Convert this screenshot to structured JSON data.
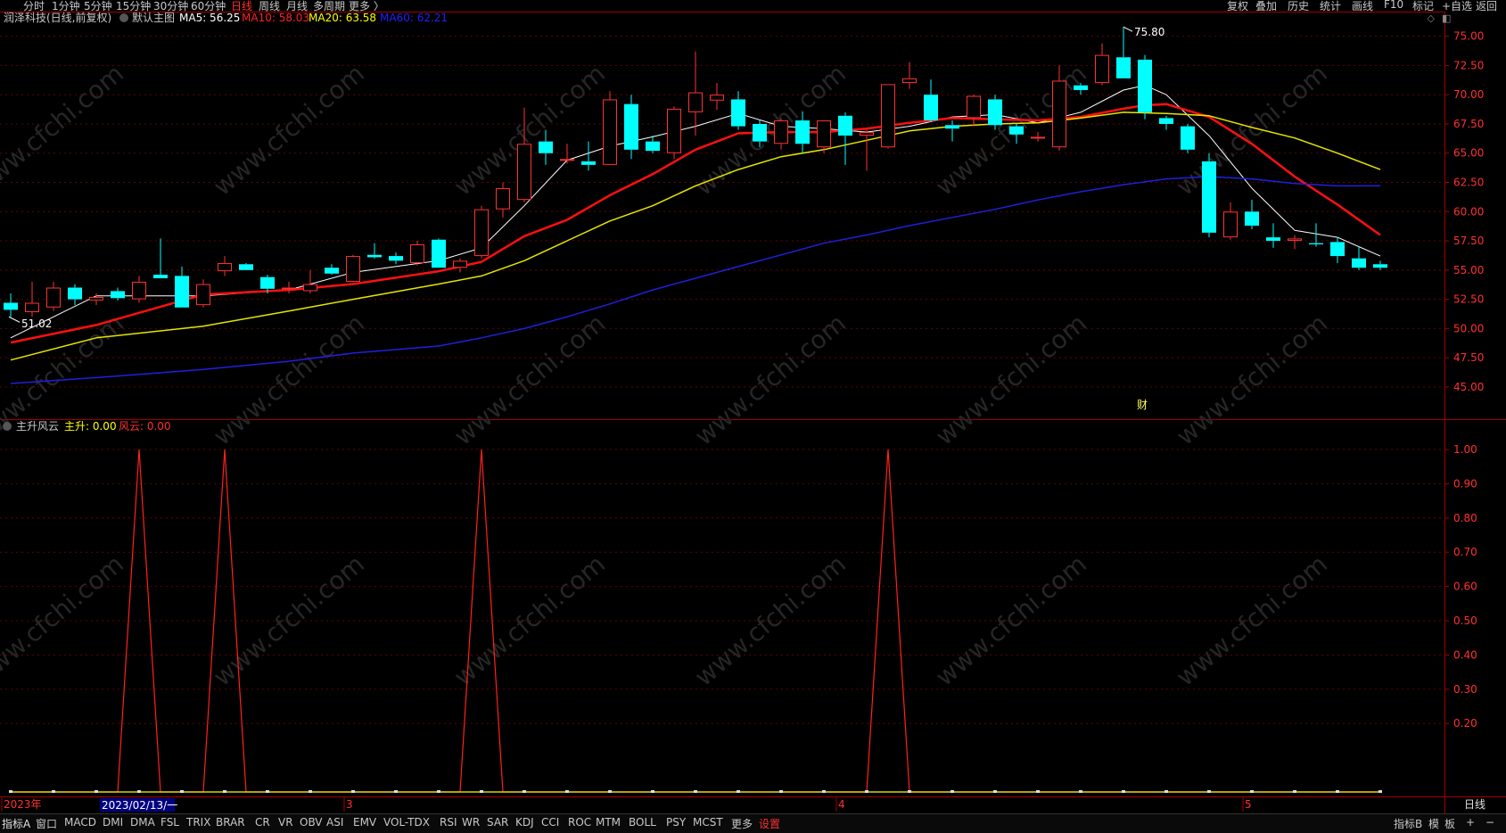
{
  "period_tabs": [
    "分时",
    "1分钟",
    "5分钟",
    "15分钟",
    "30分钟",
    "60分钟",
    "日线",
    "周线",
    "月线",
    "多周期",
    "更多 〉"
  ],
  "active_period": "日线",
  "toolbar_right": [
    "复权",
    "叠加",
    "历史",
    "统计",
    "画线",
    "F10",
    "标记",
    "+自选",
    "返回"
  ],
  "main_panel": {
    "title": "润泽科技(日线,前复权)",
    "indicator_name": "默认主图",
    "ma_labels": [
      {
        "text": "MA5: 56.25",
        "color": "#ffffff"
      },
      {
        "text": "MA10: 58.03",
        "color": "#ff2020"
      },
      {
        "text": "MA20: 63.58",
        "color": "#ffff00"
      },
      {
        "text": "MA60: 62.21",
        "color": "#2020ff"
      }
    ],
    "high_marker": "75.80",
    "low_marker": "51.02",
    "event_marker": "财"
  },
  "sub_panel": {
    "title": "主升风云",
    "labels": [
      {
        "text": "主升: 0.00",
        "color": "#ffff00"
      },
      {
        "text": "风云: 0.00",
        "color": "#ff3030"
      }
    ]
  },
  "date_axis": {
    "labels": [
      {
        "text": "2023年",
        "index": 0
      },
      {
        "text": "3",
        "index": 16
      },
      {
        "text": "4",
        "index": 39
      },
      {
        "text": "5",
        "index": 58
      }
    ],
    "cursor_label": "2023/02/13/一",
    "cursor_index": 5,
    "period_label": "日线"
  },
  "bottom_tabs": [
    "指标A",
    "窗口",
    "MACD",
    "DMI",
    "DMA",
    "FSL",
    "TRIX",
    "BRAR",
    "CR",
    "VR",
    "OBV",
    "ASI",
    "EMV",
    "VOL-TDX",
    "RSI",
    "WR",
    "SAR",
    "KDJ",
    "CCI",
    "ROC",
    "MTM",
    "BOLL",
    "PSY",
    "MCST",
    "更多",
    "设置"
  ],
  "bottom_right": [
    "指标B",
    "模",
    "板",
    "+",
    "−"
  ],
  "chart_data": [
    {
      "type": "candlestick",
      "title": "润泽科技(日线,前复权)",
      "ylim": [
        44,
        76.5
      ],
      "yticks": [
        45,
        47.5,
        50,
        52.5,
        55,
        57.5,
        60,
        62.5,
        65,
        67.5,
        70,
        72.5,
        75
      ],
      "ytick_labels": [
        "45.00",
        "47.50",
        "50.00",
        "52.50",
        "55.00",
        "57.50",
        "60.00",
        "62.50",
        "65.00",
        "67.50",
        "70.00",
        "72.50",
        "75.00"
      ],
      "up_color": "#ff3232",
      "down_color": "#00ffff",
      "candles": [
        {
          "o": 52.2,
          "h": 53.0,
          "l": 51.0,
          "c": 51.6
        },
        {
          "o": 51.4,
          "h": 54.0,
          "l": 51.0,
          "c": 52.2
        },
        {
          "o": 51.8,
          "h": 54.0,
          "l": 51.5,
          "c": 53.5
        },
        {
          "o": 53.5,
          "h": 53.8,
          "l": 52.0,
          "c": 52.5
        },
        {
          "o": 52.4,
          "h": 53.0,
          "l": 52.0,
          "c": 52.7
        },
        {
          "o": 53.2,
          "h": 53.5,
          "l": 52.4,
          "c": 52.6
        },
        {
          "o": 52.5,
          "h": 54.5,
          "l": 52.2,
          "c": 54.0
        },
        {
          "o": 54.6,
          "h": 57.7,
          "l": 54.3,
          "c": 54.3
        },
        {
          "o": 54.5,
          "h": 55.3,
          "l": 51.8,
          "c": 51.8
        },
        {
          "o": 52.0,
          "h": 54.2,
          "l": 51.8,
          "c": 53.8
        },
        {
          "o": 54.9,
          "h": 56.2,
          "l": 54.5,
          "c": 55.6
        },
        {
          "o": 55.5,
          "h": 55.6,
          "l": 55.0,
          "c": 55.0
        },
        {
          "o": 54.4,
          "h": 54.6,
          "l": 53.0,
          "c": 53.4
        },
        {
          "o": 53.5,
          "h": 54.0,
          "l": 53.0,
          "c": 53.5
        },
        {
          "o": 53.2,
          "h": 55.0,
          "l": 53.0,
          "c": 53.8
        },
        {
          "o": 55.2,
          "h": 55.5,
          "l": 54.6,
          "c": 54.7
        },
        {
          "o": 54.0,
          "h": 56.3,
          "l": 54.0,
          "c": 56.2
        },
        {
          "o": 56.3,
          "h": 57.3,
          "l": 56.0,
          "c": 56.1
        },
        {
          "o": 56.2,
          "h": 56.5,
          "l": 55.5,
          "c": 55.8
        },
        {
          "o": 55.6,
          "h": 57.5,
          "l": 55.4,
          "c": 57.2
        },
        {
          "o": 57.6,
          "h": 57.7,
          "l": 55.2,
          "c": 55.2
        },
        {
          "o": 55.2,
          "h": 56.0,
          "l": 54.8,
          "c": 55.8
        },
        {
          "o": 56.2,
          "h": 60.5,
          "l": 56.0,
          "c": 60.2
        },
        {
          "o": 60.2,
          "h": 62.5,
          "l": 59.5,
          "c": 62.0
        },
        {
          "o": 61.0,
          "h": 68.9,
          "l": 60.8,
          "c": 65.8
        },
        {
          "o": 66.0,
          "h": 67.0,
          "l": 64.0,
          "c": 65.0
        },
        {
          "o": 64.5,
          "h": 65.8,
          "l": 64.1,
          "c": 64.5
        },
        {
          "o": 64.3,
          "h": 66.0,
          "l": 63.5,
          "c": 64.0
        },
        {
          "o": 64.0,
          "h": 70.3,
          "l": 64.0,
          "c": 69.6
        },
        {
          "o": 69.2,
          "h": 70.0,
          "l": 64.5,
          "c": 65.3
        },
        {
          "o": 66.0,
          "h": 66.5,
          "l": 65.0,
          "c": 65.2
        },
        {
          "o": 65.0,
          "h": 69.0,
          "l": 64.5,
          "c": 68.8
        },
        {
          "o": 68.5,
          "h": 73.7,
          "l": 66.5,
          "c": 70.2
        },
        {
          "o": 69.5,
          "h": 71.0,
          "l": 68.7,
          "c": 70.0
        },
        {
          "o": 69.6,
          "h": 70.3,
          "l": 67.0,
          "c": 67.3
        },
        {
          "o": 67.5,
          "h": 67.8,
          "l": 65.5,
          "c": 66.0
        },
        {
          "o": 65.8,
          "h": 68.0,
          "l": 65.3,
          "c": 67.8
        },
        {
          "o": 67.8,
          "h": 68.5,
          "l": 65.0,
          "c": 65.8
        },
        {
          "o": 65.5,
          "h": 67.0,
          "l": 65.0,
          "c": 67.8
        },
        {
          "o": 68.2,
          "h": 68.5,
          "l": 64.0,
          "c": 66.5
        },
        {
          "o": 66.5,
          "h": 67.0,
          "l": 63.5,
          "c": 66.8
        },
        {
          "o": 65.5,
          "h": 70.9,
          "l": 65.4,
          "c": 70.9
        },
        {
          "o": 71.0,
          "h": 72.8,
          "l": 70.5,
          "c": 71.4
        },
        {
          "o": 70.0,
          "h": 71.3,
          "l": 67.7,
          "c": 67.8
        },
        {
          "o": 67.4,
          "h": 67.8,
          "l": 66.0,
          "c": 67.1
        },
        {
          "o": 68.0,
          "h": 70.0,
          "l": 67.3,
          "c": 69.9
        },
        {
          "o": 69.6,
          "h": 70.0,
          "l": 67.0,
          "c": 67.4
        },
        {
          "o": 67.3,
          "h": 67.5,
          "l": 65.8,
          "c": 66.6
        },
        {
          "o": 66.3,
          "h": 66.8,
          "l": 66.0,
          "c": 66.4
        },
        {
          "o": 65.5,
          "h": 72.5,
          "l": 65.2,
          "c": 71.2
        },
        {
          "o": 70.8,
          "h": 71.0,
          "l": 70.0,
          "c": 70.4
        },
        {
          "o": 71.0,
          "h": 74.4,
          "l": 70.8,
          "c": 73.4
        },
        {
          "o": 73.2,
          "h": 75.8,
          "l": 71.4,
          "c": 71.4
        },
        {
          "o": 73.0,
          "h": 73.4,
          "l": 67.9,
          "c": 68.5
        },
        {
          "o": 68.0,
          "h": 68.2,
          "l": 67.0,
          "c": 67.5
        },
        {
          "o": 67.3,
          "h": 67.5,
          "l": 65.0,
          "c": 65.3
        },
        {
          "o": 64.3,
          "h": 65.0,
          "l": 57.8,
          "c": 58.2
        },
        {
          "o": 57.8,
          "h": 60.8,
          "l": 57.6,
          "c": 60.0
        },
        {
          "o": 60.0,
          "h": 61.0,
          "l": 58.5,
          "c": 58.8
        },
        {
          "o": 57.8,
          "h": 59.0,
          "l": 56.9,
          "c": 57.5
        },
        {
          "o": 57.5,
          "h": 58.0,
          "l": 56.8,
          "c": 57.7
        },
        {
          "o": 57.3,
          "h": 59.0,
          "l": 57.0,
          "c": 57.2
        },
        {
          "o": 57.4,
          "h": 57.8,
          "l": 55.6,
          "c": 56.2
        },
        {
          "o": 56.0,
          "h": 57.0,
          "l": 55.0,
          "c": 55.2
        },
        {
          "o": 55.5,
          "h": 55.8,
          "l": 55.0,
          "c": 55.2
        }
      ],
      "ma_series": [
        {
          "name": "MA5",
          "color": "#ffffff",
          "width": 1,
          "points": [
            [
              0,
              49.2
            ],
            [
              4,
              52.8
            ],
            [
              9,
              52.8
            ],
            [
              13,
              53.3
            ],
            [
              16,
              54.8
            ],
            [
              20,
              55.8
            ],
            [
              22,
              56.9
            ],
            [
              24,
              60.5
            ],
            [
              26,
              64.4
            ],
            [
              28,
              65.6
            ],
            [
              30,
              66.4
            ],
            [
              32,
              67.3
            ],
            [
              34,
              68.4
            ],
            [
              36,
              67.3
            ],
            [
              38,
              67.1
            ],
            [
              40,
              66.8
            ],
            [
              42,
              67.3
            ],
            [
              44,
              68.1
            ],
            [
              46,
              68.3
            ],
            [
              48,
              67.6
            ],
            [
              50,
              68.5
            ],
            [
              52,
              70.4
            ],
            [
              53,
              70.8
            ],
            [
              54,
              70.0
            ],
            [
              56,
              66.5
            ],
            [
              58,
              62.0
            ],
            [
              60,
              58.4
            ],
            [
              62,
              57.8
            ],
            [
              64,
              56.2
            ]
          ]
        },
        {
          "name": "MA10",
          "color": "#ff1010",
          "width": 2.5,
          "points": [
            [
              0,
              48.8
            ],
            [
              4,
              50.3
            ],
            [
              9,
              52.9
            ],
            [
              13,
              53.3
            ],
            [
              16,
              53.8
            ],
            [
              20,
              54.9
            ],
            [
              22,
              55.7
            ],
            [
              24,
              57.9
            ],
            [
              26,
              59.3
            ],
            [
              28,
              61.4
            ],
            [
              30,
              63.2
            ],
            [
              32,
              65.3
            ],
            [
              34,
              66.7
            ],
            [
              36,
              66.8
            ],
            [
              38,
              66.8
            ],
            [
              40,
              67.1
            ],
            [
              42,
              67.6
            ],
            [
              44,
              68.0
            ],
            [
              46,
              67.9
            ],
            [
              48,
              67.8
            ],
            [
              50,
              68.1
            ],
            [
              52,
              68.8
            ],
            [
              53,
              69.1
            ],
            [
              54,
              69.2
            ],
            [
              56,
              68.1
            ],
            [
              58,
              65.8
            ],
            [
              60,
              63.0
            ],
            [
              62,
              60.6
            ],
            [
              64,
              58.0
            ]
          ]
        },
        {
          "name": "MA20",
          "color": "#e6e600",
          "width": 1.5,
          "points": [
            [
              0,
              47.3
            ],
            [
              4,
              49.2
            ],
            [
              9,
              50.2
            ],
            [
              13,
              51.5
            ],
            [
              16,
              52.5
            ],
            [
              20,
              53.8
            ],
            [
              22,
              54.5
            ],
            [
              24,
              55.8
            ],
            [
              26,
              57.5
            ],
            [
              28,
              59.2
            ],
            [
              30,
              60.5
            ],
            [
              32,
              62.2
            ],
            [
              34,
              63.6
            ],
            [
              36,
              64.7
            ],
            [
              38,
              65.3
            ],
            [
              40,
              66.1
            ],
            [
              42,
              66.9
            ],
            [
              44,
              67.3
            ],
            [
              46,
              67.5
            ],
            [
              48,
              67.6
            ],
            [
              50,
              68.0
            ],
            [
              52,
              68.5
            ],
            [
              54,
              68.4
            ],
            [
              56,
              68.2
            ],
            [
              58,
              67.2
            ],
            [
              60,
              66.3
            ],
            [
              62,
              65.0
            ],
            [
              64,
              63.6
            ]
          ]
        },
        {
          "name": "MA60",
          "color": "#2020dd",
          "width": 1.5,
          "points": [
            [
              0,
              45.3
            ],
            [
              4,
              45.8
            ],
            [
              9,
              46.5
            ],
            [
              13,
              47.2
            ],
            [
              16,
              47.9
            ],
            [
              20,
              48.5
            ],
            [
              22,
              49.2
            ],
            [
              24,
              50.0
            ],
            [
              26,
              51.0
            ],
            [
              28,
              52.1
            ],
            [
              30,
              53.3
            ],
            [
              32,
              54.3
            ],
            [
              34,
              55.3
            ],
            [
              36,
              56.3
            ],
            [
              38,
              57.3
            ],
            [
              40,
              58.0
            ],
            [
              42,
              58.8
            ],
            [
              44,
              59.5
            ],
            [
              46,
              60.2
            ],
            [
              48,
              61.0
            ],
            [
              50,
              61.7
            ],
            [
              52,
              62.3
            ],
            [
              54,
              62.8
            ],
            [
              56,
              63.0
            ],
            [
              58,
              62.8
            ],
            [
              60,
              62.4
            ],
            [
              62,
              62.2
            ],
            [
              64,
              62.21
            ]
          ]
        }
      ]
    },
    {
      "type": "line",
      "title": "主升风云",
      "ylim": [
        0,
        1.04
      ],
      "yticks": [
        0.2,
        0.3,
        0.4,
        0.5,
        0.6,
        0.7,
        0.8,
        0.9,
        1.0
      ],
      "ytick_labels": [
        "0.20",
        "0.30",
        "0.40",
        "0.50",
        "0.60",
        "0.70",
        "0.80",
        "0.90",
        "1.00"
      ],
      "series": [
        {
          "name": "风云",
          "color": "#ff2020",
          "points": [
            [
              0,
              0
            ],
            [
              5,
              0
            ],
            [
              6,
              1
            ],
            [
              7,
              0
            ],
            [
              9,
              0
            ],
            [
              10,
              1
            ],
            [
              11,
              0
            ],
            [
              21,
              0
            ],
            [
              22,
              1
            ],
            [
              23,
              0
            ],
            [
              40,
              0
            ],
            [
              41,
              1
            ],
            [
              42,
              0
            ],
            [
              64,
              0
            ]
          ]
        },
        {
          "name": "主升",
          "color": "#ffff00",
          "points": [
            [
              0,
              0
            ],
            [
              64,
              0
            ]
          ]
        }
      ]
    }
  ]
}
